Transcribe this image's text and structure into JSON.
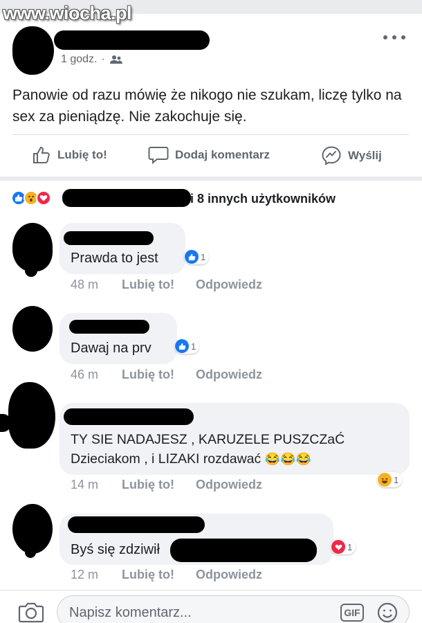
{
  "watermark": "www.wiocha.pl",
  "post": {
    "time": "1 godz.",
    "separator": "·",
    "audience_icon": "friends-icon",
    "text": "Panowie od razu mówię że nikogo nie szukam, liczę tylko na sex za pieniądzę. Nie zakochuje się."
  },
  "actions": {
    "like": "Lubię to!",
    "comment": "Dodaj komentarz",
    "send": "Wyślij"
  },
  "reactions_summary": {
    "icons": [
      "like-icon",
      "wow-icon",
      "love-icon"
    ],
    "text": "i 8 innych użytkowników"
  },
  "comments": [
    {
      "text": "Prawda to jest",
      "time": "48 m",
      "like": "Lubię to!",
      "reply": "Odpowiedz",
      "reaction_count": "1",
      "reaction_icon": "like-icon"
    },
    {
      "text": "Dawaj na prv",
      "time": "46 m",
      "like": "Lubię to!",
      "reply": "Odpowiedz",
      "reaction_count": "1",
      "reaction_icon": "like-icon"
    },
    {
      "text_line1": "TY SIE NADAJESZ , KARUZELE  PUSZCZaĆ",
      "text_line2": "Dzieciakom , i LIZAKI rozdawać",
      "emoji": "😂😂😂",
      "time": "14 m",
      "like": "Lubię to!",
      "reply": "Odpowiedz",
      "reaction_count": "1",
      "reaction_icon": "haha-icon"
    },
    {
      "text": "Byś się zdziwił",
      "time": "12 m",
      "like": "Lubię to!",
      "reply": "Odpowiedz",
      "reaction_count": "1",
      "reaction_icon": "love-icon"
    }
  ],
  "composer": {
    "placeholder": "Napisz komentarz...",
    "gif_label": "GIF"
  },
  "colors": {
    "like_blue": "#1877f2",
    "love_red": "#f02849",
    "wow_yellow": "#f7b125",
    "meta_gray": "#606770"
  }
}
